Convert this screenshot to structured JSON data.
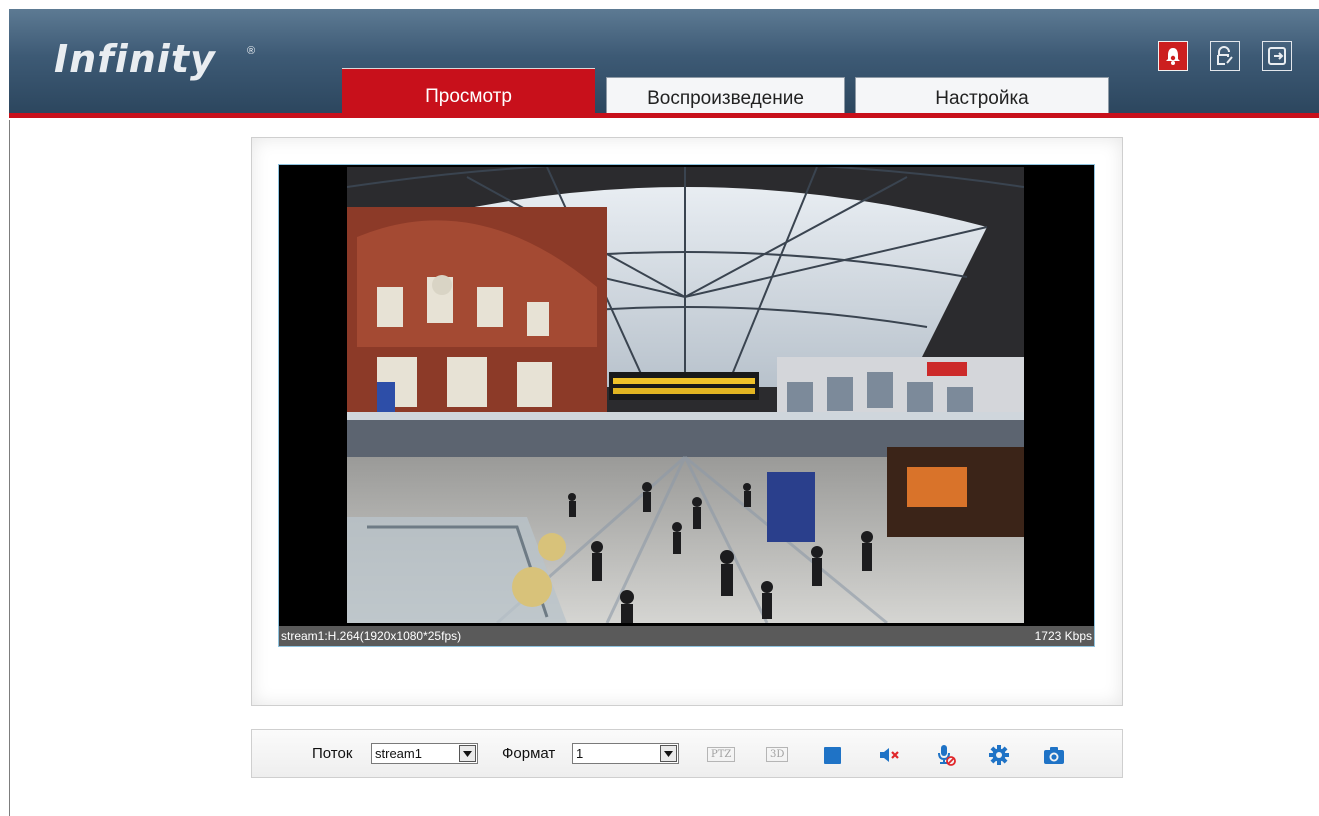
{
  "header": {
    "logo": "Infinity",
    "logo_mark": "®",
    "tabs": [
      {
        "label": "Просмотр",
        "active": true
      },
      {
        "label": "Воспроизведение",
        "active": false
      },
      {
        "label": "Настройка",
        "active": false
      }
    ],
    "buttons": [
      {
        "icon": "alarm-bell-icon",
        "color": "#cc1f1f"
      },
      {
        "icon": "user-edit-icon"
      },
      {
        "icon": "logout-icon"
      }
    ]
  },
  "video": {
    "stream_info": "stream1:H.264(1920x1080*25fps)",
    "bitrate": "1723 Kbps"
  },
  "toolbar": {
    "stream_label": "Поток",
    "stream_value": "stream1",
    "format_label": "Формат",
    "format_value": "1",
    "ptz_label": "PTZ",
    "three_d_label": "3D",
    "icons": [
      "stop-icon",
      "mute-icon",
      "microphone-off-icon",
      "settings-icon",
      "camera-snapshot-icon"
    ]
  },
  "colors": {
    "accent": "#c8101b",
    "header": "#3d5a75",
    "icon_blue": "#1f73c6"
  }
}
